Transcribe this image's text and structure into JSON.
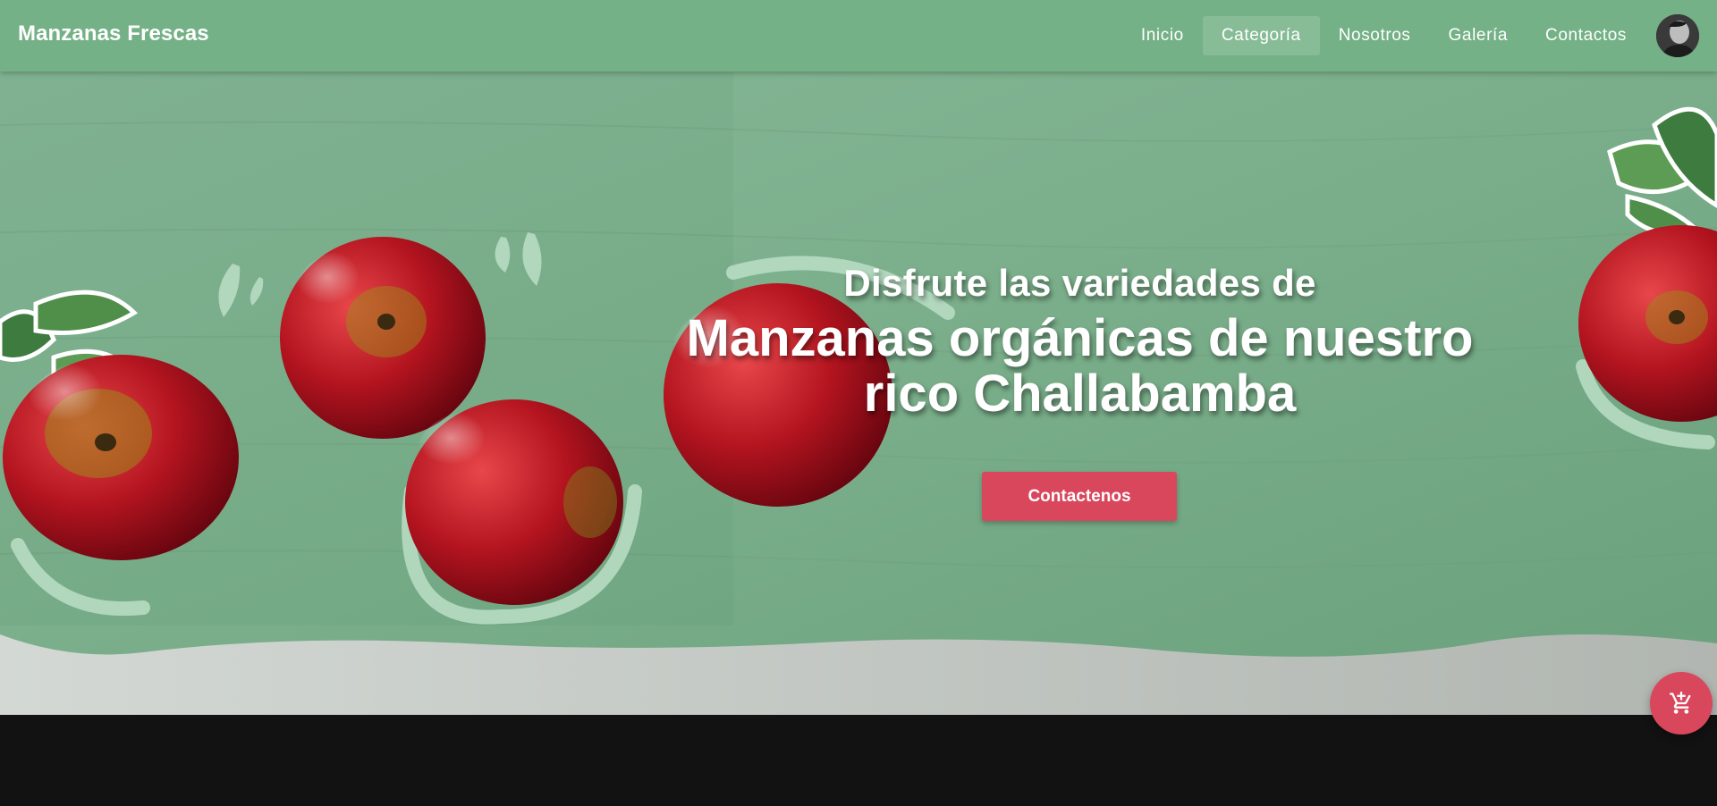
{
  "app": {
    "brand": "Manzanas Frescas"
  },
  "nav": {
    "items": [
      {
        "label": "Inicio",
        "active": false
      },
      {
        "label": "Categoría",
        "active": true
      },
      {
        "label": "Nosotros",
        "active": false
      },
      {
        "label": "Galería",
        "active": false
      },
      {
        "label": "Contactos",
        "active": false
      }
    ],
    "avatar_icon": "user-avatar"
  },
  "hero": {
    "subtitle": "Disfrute las variedades de",
    "title_line1": "Manzanas orgánicas de nuestro",
    "title_line2": "rico Challabamba",
    "cta_label": "Contactenos"
  },
  "fab": {
    "icon": "add-shopping-cart-icon"
  },
  "colors": {
    "appbar": "#74b186",
    "hero_bg": "#7fb08e",
    "accent": "#d9475c",
    "dark_band": "#121212",
    "wave": "#c4cbc5"
  }
}
